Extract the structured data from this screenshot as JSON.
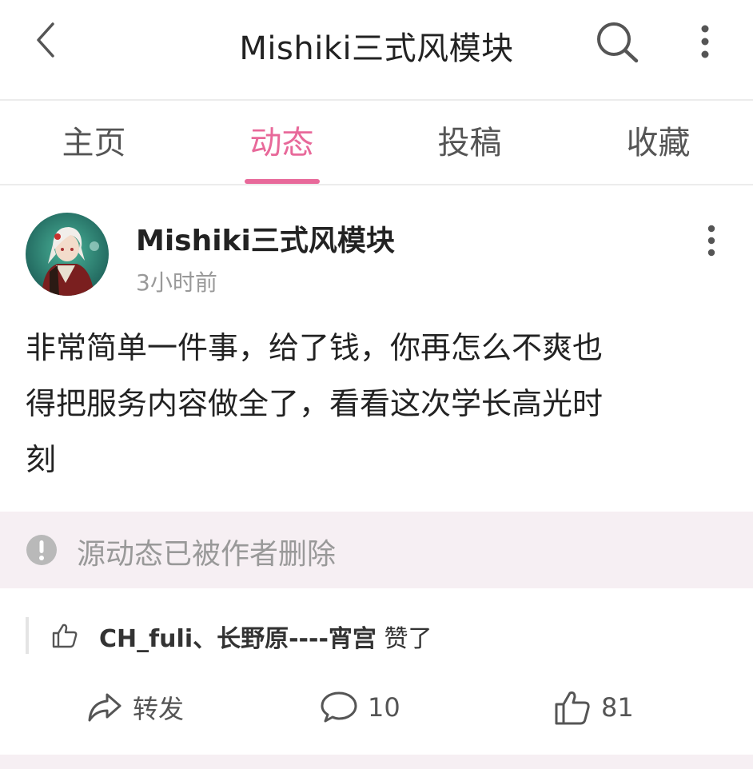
{
  "header": {
    "title": "Mishiki三式风模块",
    "back_icon": "chevron-left-icon",
    "search_icon": "search-icon",
    "more_icon": "more-vertical-icon"
  },
  "tabs": [
    {
      "label": "主页",
      "active": false
    },
    {
      "label": "动态",
      "active": true
    },
    {
      "label": "投稿",
      "active": false
    },
    {
      "label": "收藏",
      "active": false
    }
  ],
  "post": {
    "author": "Mishiki三式风模块",
    "time": "3小时前",
    "body_lines": [
      "非常简单一件事，给了钱，你再怎么不爽也",
      "得把服务内容做全了，看看这次学长高光时",
      "刻"
    ],
    "deleted_notice": "源动态已被作者删除",
    "likes": {
      "names": "CH_fuli、长野原----宵宫",
      "suffix": " 赞了"
    },
    "actions": {
      "share_label": "转发",
      "comment_count": "10",
      "like_count": "81"
    }
  },
  "colors": {
    "accent": "#e8699a",
    "muted_text": "#999999",
    "deleted_bg": "#f6eff3"
  }
}
